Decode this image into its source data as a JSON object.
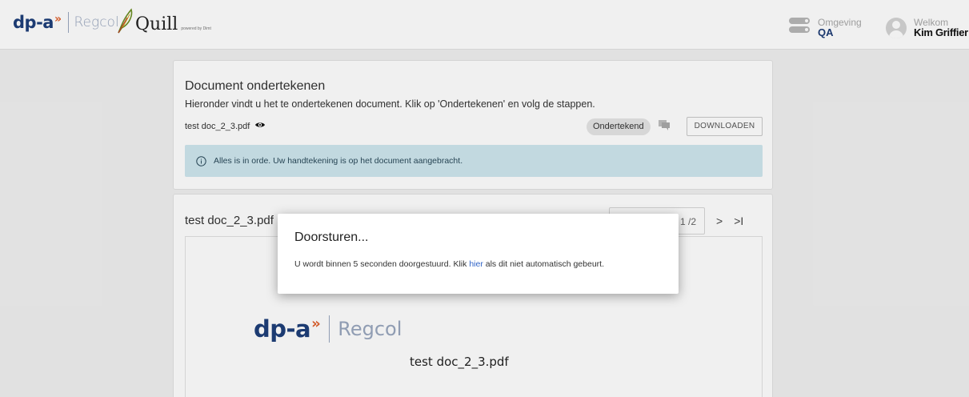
{
  "header": {
    "logo_dp": "dp-a",
    "logo_arrows": "»",
    "logo_regcol": "Regcol",
    "product_name": "Quill",
    "product_tagline": "powered by Dimt",
    "environment": {
      "label": "Omgeving",
      "value": "QA"
    },
    "user": {
      "greeting": "Welkom",
      "name": "Kim Griffier"
    }
  },
  "document_card": {
    "title": "Document ondertekenen",
    "subtitle": "Hieronder vindt u het te ondertekenen document. Klik op 'Ondertekenen' en volg de stappen.",
    "file_name": "test doc_2_3.pdf",
    "status_badge": "Ondertekend",
    "download_label": "DOWNLOADEN",
    "alert_text": "Alles is in orde. Uw handtekening is op het document aangebracht."
  },
  "viewer_card": {
    "title": "test doc_2_3.pdf",
    "page_indicator": "1 /2",
    "next_label": ">",
    "last_label": ">I",
    "pdf_logo_dp": "dp-a",
    "pdf_logo_arrows": "»",
    "pdf_logo_regcol": "Regcol",
    "pdf_file_name": "test doc_2_3.pdf"
  },
  "modal": {
    "title": "Doorsturen...",
    "body_before": "U wordt binnen 5 seconden doorgestuurd. Klik ",
    "link_text": "hier",
    "body_after": " als dit niet automatisch gebeurt."
  },
  "colors": {
    "brand_blue": "#1e3f7a",
    "brand_orange": "#e0602c",
    "alert_background": "#cfe7ef",
    "link": "#2f63c7"
  },
  "icons": {
    "eye": "eye-icon",
    "comment": "comment-icon",
    "info": "info-icon",
    "avatar": "user-avatar-icon",
    "environment_toggle": "toggle-icon",
    "quill_feather": "feather-icon"
  }
}
